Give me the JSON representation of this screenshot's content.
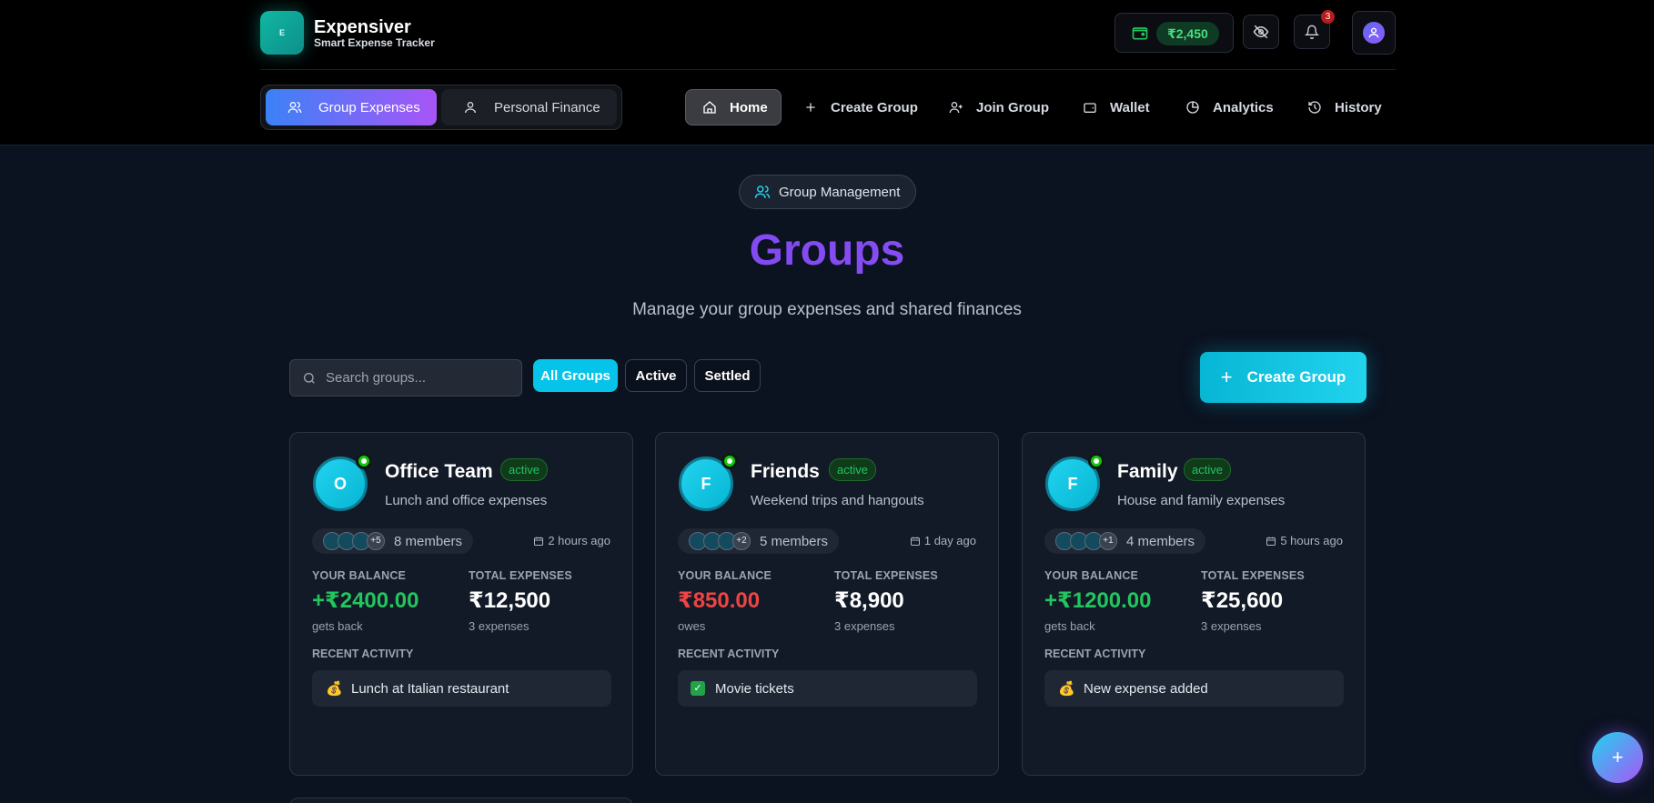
{
  "brand": {
    "logo_text": "E",
    "name": "Expensiver",
    "tagline": "Smart Expense Tracker"
  },
  "header": {
    "wallet_balance": "₹2,450",
    "notification_count": "3"
  },
  "mode_switch": {
    "group_label": "Group Expenses",
    "personal_label": "Personal Finance"
  },
  "nav": {
    "home": "Home",
    "create_group": "Create Group",
    "join_group": "Join Group",
    "wallet": "Wallet",
    "analytics": "Analytics",
    "history": "History"
  },
  "main": {
    "chip": "Group Management",
    "title": "Groups",
    "subtitle": "Manage your group expenses and shared finances",
    "search_placeholder": "Search groups...",
    "filters": {
      "all": "All Groups",
      "active": "Active",
      "settled": "Settled"
    },
    "create_button": "Create Group"
  },
  "labels": {
    "your_balance": "YOUR BALANCE",
    "total_expenses": "TOTAL EXPENSES",
    "recent_activity": "RECENT ACTIVITY"
  },
  "groups": [
    {
      "initial": "O",
      "name": "Office Team",
      "status": "active",
      "description": "Lunch and office expenses",
      "extra_members": "+5",
      "members": "8 members",
      "updated": "2 hours ago",
      "balance": "+₹2400.00",
      "balance_note": "gets back",
      "total": "₹12,500",
      "expense_count": "3 expenses",
      "activity_icon": "💰",
      "activity": "Lunch at Italian restaurant"
    },
    {
      "initial": "F",
      "name": "Friends",
      "status": "active",
      "description": "Weekend trips and hangouts",
      "extra_members": "+2",
      "members": "5 members",
      "updated": "1 day ago",
      "balance": "₹850.00",
      "balance_note": "owes",
      "total": "₹8,900",
      "expense_count": "3 expenses",
      "activity_icon": "✓",
      "activity": "Movie tickets"
    },
    {
      "initial": "F",
      "name": "Family",
      "status": "active",
      "description": "House and family expenses",
      "extra_members": "+1",
      "members": "4 members",
      "updated": "5 hours ago",
      "balance": "+₹1200.00",
      "balance_note": "gets back",
      "total": "₹25,600",
      "expense_count": "3 expenses",
      "activity_icon": "💰",
      "activity": "New expense added"
    }
  ],
  "fab": {
    "label": "+"
  },
  "colors": {
    "accent_cyan": "#06b6d4",
    "accent_purple": "#7c3aed",
    "positive": "#22c55e",
    "negative": "#ef4444"
  }
}
